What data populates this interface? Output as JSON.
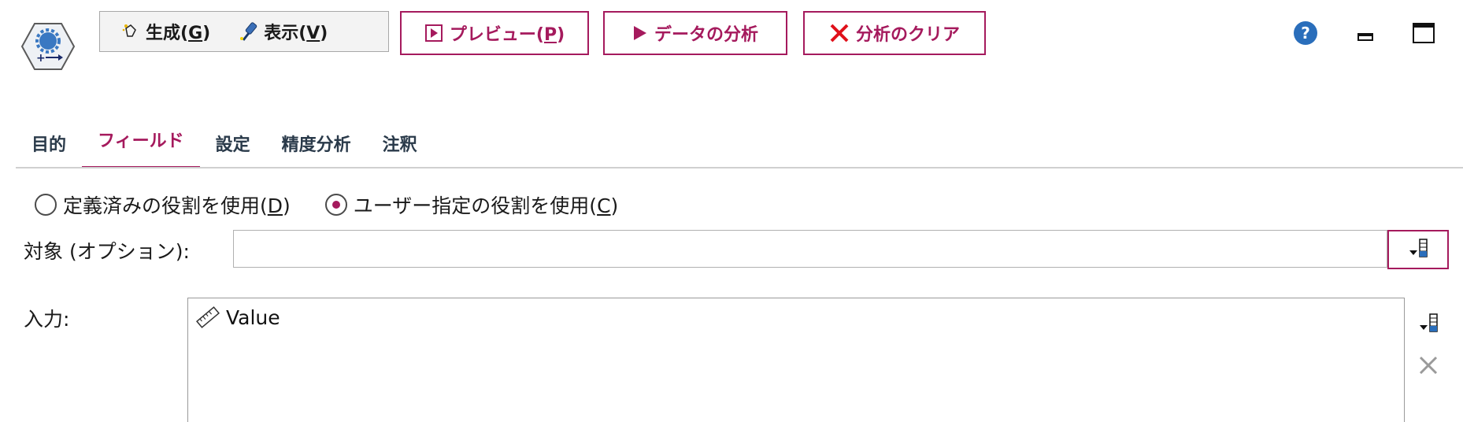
{
  "toolbar": {
    "generate_label": "生成(",
    "generate_mnemonic": "G",
    "view_label": "表示(",
    "view_mnemonic": "V",
    "preview_label": "プレビュー(",
    "preview_mnemonic": "P",
    "analyze_label": "データの分析",
    "clear_label": "分析のクリア",
    "generate_icon": "wand-icon",
    "view_icon": "flashlight-icon",
    "preview_icon": "play-box-icon",
    "analyze_icon": "play-icon",
    "clear_icon": "x-icon"
  },
  "window": {
    "help_icon": "help-icon",
    "minimize_icon": "minimize-icon",
    "maximize_icon": "maximize-icon"
  },
  "tabs": [
    {
      "label": "目的",
      "active": false
    },
    {
      "label": "フィールド",
      "active": true
    },
    {
      "label": "設定",
      "active": false
    },
    {
      "label": "精度分析",
      "active": false
    },
    {
      "label": "注釈",
      "active": false
    }
  ],
  "roles": {
    "predefined_label": "定義済みの役割を使用(",
    "predefined_mnemonic": "D",
    "custom_label": "ユーザー指定の役割を使用(",
    "custom_mnemonic": "C",
    "selected": "custom"
  },
  "target": {
    "label": "対象 (オプション):",
    "value": ""
  },
  "inputs": {
    "label": "入力:",
    "items": [
      {
        "name": "Value",
        "icon": "ruler-icon"
      }
    ]
  },
  "colors": {
    "accent": "#a51a5d",
    "help": "#2a6ebb"
  }
}
